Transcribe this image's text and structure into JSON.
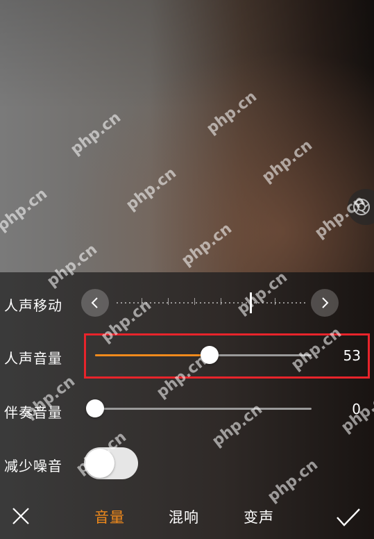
{
  "vocal_shift": {
    "label": "人声移动"
  },
  "vocal_volume": {
    "label": "人声音量",
    "value": "53",
    "percent": 53
  },
  "accompaniment_volume": {
    "label": "伴奏音量",
    "value": "0",
    "percent": 0
  },
  "noise_reduction": {
    "label": "减少噪音",
    "enabled": false
  },
  "bottom_tabs": [
    {
      "label": "音量",
      "active": true
    },
    {
      "label": "混响",
      "active": false
    },
    {
      "label": "变声",
      "active": false
    }
  ],
  "watermark": "php.cn",
  "colors": {
    "accent": "#f08a1c",
    "highlight": "#e8242b"
  },
  "icons": [
    "close-icon",
    "check-icon",
    "chevron-left-icon",
    "chevron-right-icon",
    "shutter-icon"
  ]
}
